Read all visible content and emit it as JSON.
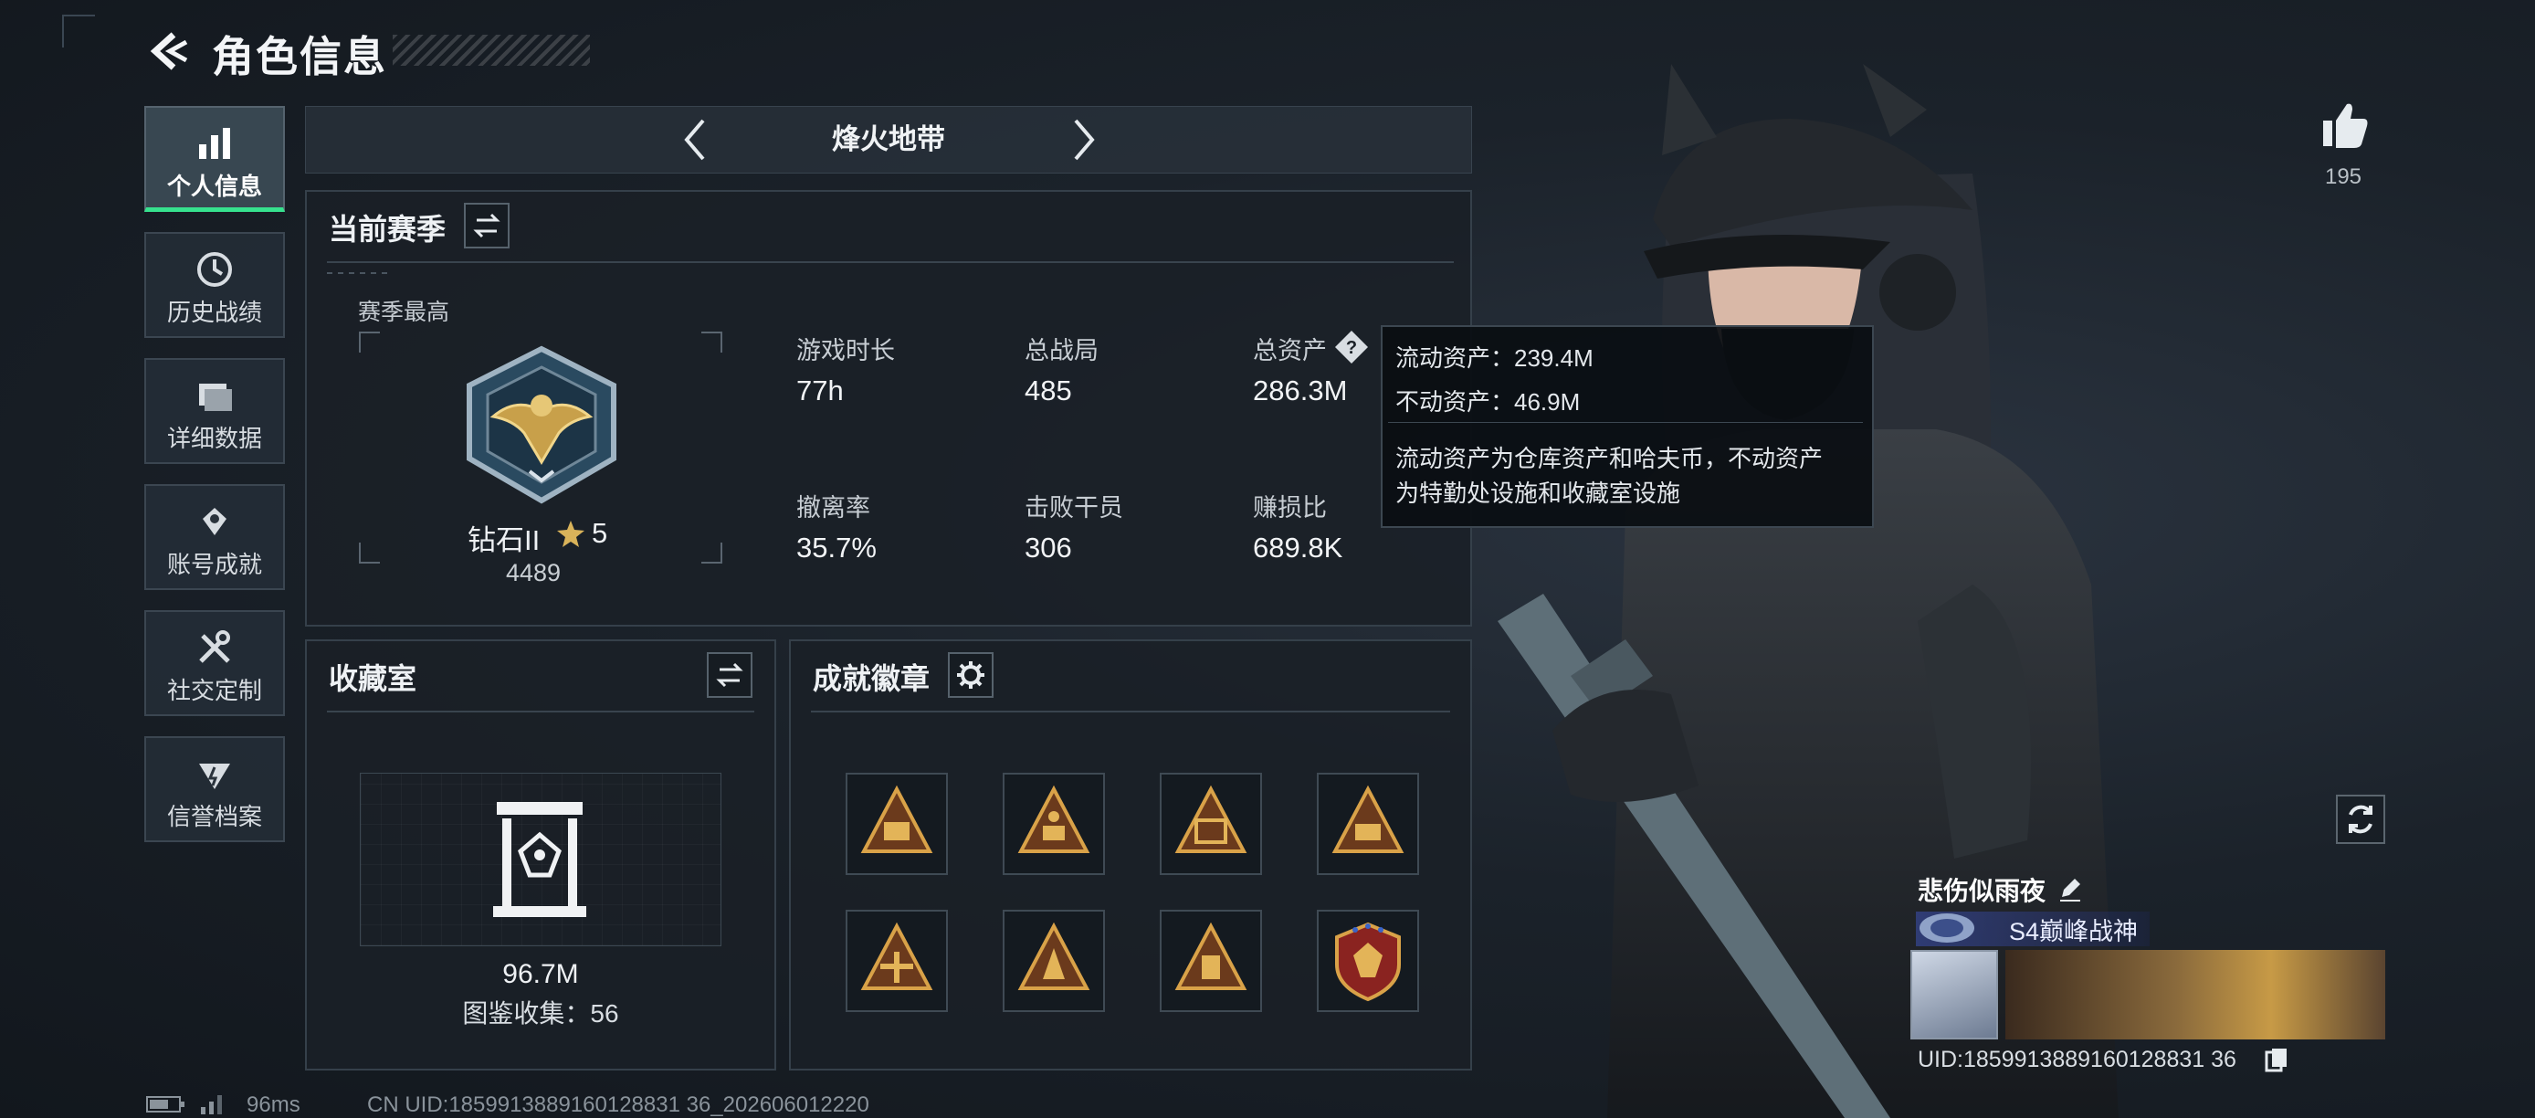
{
  "header": {
    "title": "角色信息"
  },
  "sidebar": {
    "items": [
      {
        "label": "个人信息",
        "icon": "bar-chart-icon",
        "active": true
      },
      {
        "label": "历史战绩",
        "icon": "history-icon",
        "active": false
      },
      {
        "label": "详细数据",
        "icon": "folder-icon",
        "active": false
      },
      {
        "label": "账号成就",
        "icon": "achievement-icon",
        "active": false
      },
      {
        "label": "社交定制",
        "icon": "tools-icon",
        "active": false
      },
      {
        "label": "信誉档案",
        "icon": "credit-icon",
        "active": false
      }
    ]
  },
  "mode": {
    "label": "烽火地带"
  },
  "season": {
    "title": "当前赛季",
    "best_label": "赛季最高",
    "rank_name": "钻石II",
    "rank_stars": "5",
    "rank_score": "4489",
    "stats": [
      {
        "label": "游戏时长",
        "value": "77h"
      },
      {
        "label": "总战局",
        "value": "485"
      },
      {
        "label": "总资产",
        "value": "286.3M"
      },
      {
        "label": "撤离率",
        "value": "35.7%"
      },
      {
        "label": "击败干员",
        "value": "306"
      },
      {
        "label": "赚损比",
        "value": "689.8K"
      }
    ]
  },
  "tooltip": {
    "line1": "流动资产：239.4M",
    "line2": "不动资产：46.9M",
    "desc1": "流动资产为仓库资产和哈夫币，不动资产",
    "desc2": "为特勤处设施和收藏室设施"
  },
  "collection": {
    "title": "收藏室",
    "value": "96.7M",
    "count_label": "图鉴收集：56"
  },
  "achievements": {
    "title": "成就徽章",
    "badges": [
      "badge-1",
      "badge-2",
      "badge-3",
      "badge-4",
      "badge-5",
      "badge-6",
      "badge-7",
      "badge-8"
    ]
  },
  "profile": {
    "likes": "195",
    "name": "悲伤似雨夜",
    "title_tag": "S4巅峰战神",
    "uid_text": "UID:1859913889160128831 36"
  },
  "footer": {
    "ping": "96ms",
    "uid": "CN UID:1859913889160128831 36_202606012220"
  },
  "colors": {
    "accent": "#36e28e",
    "panel_border": "#35404a",
    "gold": "#c8a04a"
  }
}
